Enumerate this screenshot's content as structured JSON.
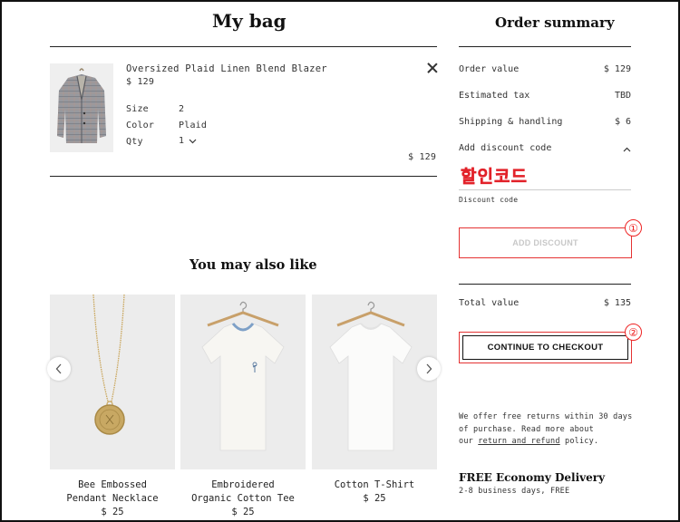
{
  "bag": {
    "title": "My bag",
    "item": {
      "name": "Oversized Plaid Linen Blend Blazer",
      "price": "$ 129",
      "size_label": "Size",
      "size_value": "2",
      "color_label": "Color",
      "color_value": "Plaid",
      "qty_label": "Qty",
      "qty_value": "1",
      "total": "$ 129"
    }
  },
  "recommendations": {
    "title": "You may also like",
    "products": [
      {
        "name_line1": "Bee Embossed",
        "name_line2": "Pendant Necklace",
        "price": "$ 25"
      },
      {
        "name_line1": "Embroidered",
        "name_line2": "Organic Cotton Tee",
        "price": "$ 25"
      },
      {
        "name_line1": "Cotton T-Shirt",
        "name_line2": "",
        "price": "$ 25"
      }
    ]
  },
  "summary": {
    "title": "Order summary",
    "order_value_label": "Order value",
    "order_value": "$ 129",
    "tax_label": "Estimated tax",
    "tax_value": "TBD",
    "shipping_label": "Shipping & handling",
    "shipping_value": "$ 6",
    "discount_toggle_label": "Add discount code",
    "discount_input_value": "할인코드",
    "discount_field_label": "Discount code",
    "add_discount_button": "ADD DISCOUNT",
    "total_label": "Total value",
    "total_value": "$ 135",
    "checkout_button": "CONTINUE TO CHECKOUT",
    "returns_line1": "We offer free returns within 30 days",
    "returns_line2": "of purchase. Read more about",
    "returns_prefix": "our",
    "returns_link": "return and refund",
    "returns_suffix": "policy.",
    "delivery_title": "FREE Economy Delivery",
    "delivery_subtitle": "2-8 business days, FREE"
  },
  "annotations": {
    "marker_1": "①",
    "marker_2": "②",
    "highlight_color": "#e53333"
  }
}
